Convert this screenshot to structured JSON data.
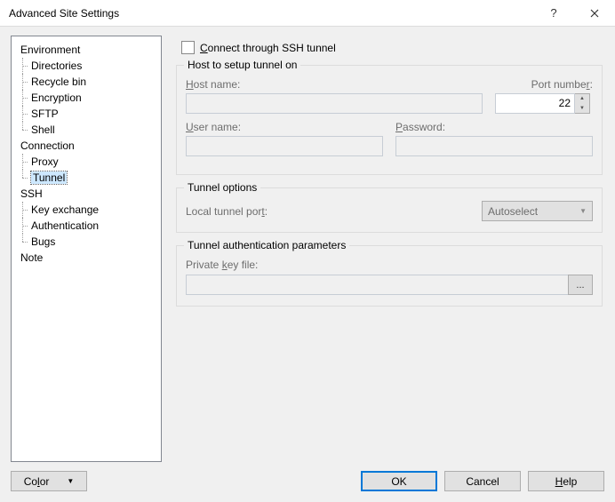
{
  "window": {
    "title": "Advanced Site Settings"
  },
  "tree": {
    "environment": "Environment",
    "directories": "Directories",
    "recycle": "Recycle bin",
    "encryption": "Encryption",
    "sftp": "SFTP",
    "shell": "Shell",
    "connection": "Connection",
    "proxy": "Proxy",
    "tunnel": "Tunnel",
    "ssh": "SSH",
    "keyexchange": "Key exchange",
    "authentication": "Authentication",
    "bugs": "Bugs",
    "note": "Note"
  },
  "main": {
    "connect_label_pre": "C",
    "connect_label_post": "onnect through SSH tunnel",
    "group_host": "Host to setup tunnel on",
    "hostname_pre": "H",
    "hostname_post": "ost name:",
    "port_pre": "Port numbe",
    "port_u": "r",
    "port_post": ":",
    "port_value": "22",
    "username_pre": "U",
    "username_post": "ser name:",
    "password_pre": "P",
    "password_post": "assword:",
    "group_options": "Tunnel options",
    "localport_pre": "Local tunnel por",
    "localport_u": "t",
    "localport_post": ":",
    "localport_value": "Autoselect",
    "group_auth": "Tunnel authentication parameters",
    "pkf_pre": "Private ",
    "pkf_u": "k",
    "pkf_post": "ey file:",
    "browse": "..."
  },
  "footer": {
    "color_pre": "Co",
    "color_u": "l",
    "color_post": "or",
    "ok": "OK",
    "cancel": "Cancel",
    "help_pre": "H",
    "help_post": "elp"
  }
}
